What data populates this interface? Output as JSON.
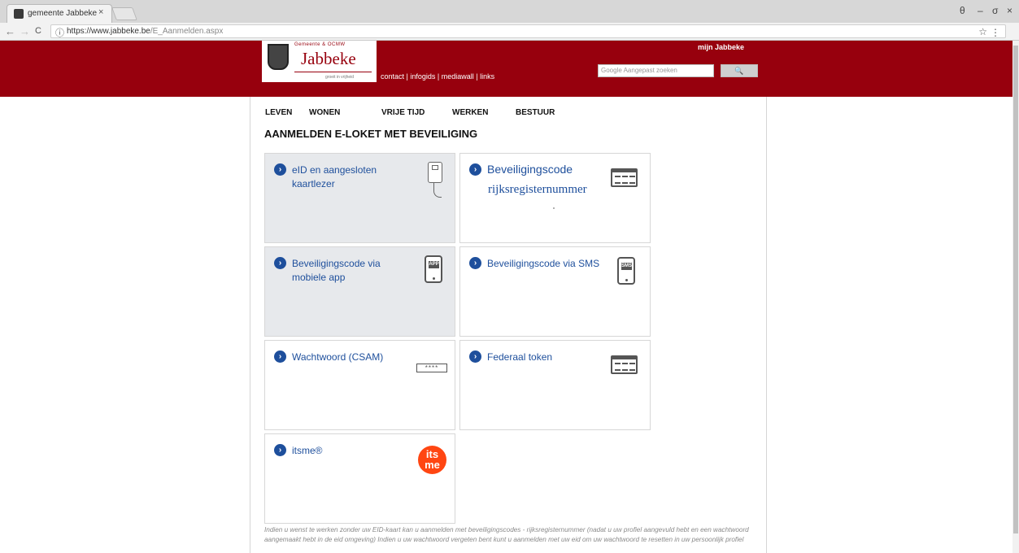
{
  "browser": {
    "tab_title": "gemeente Jabbeke",
    "tab_close": "×",
    "url_domain": "https://www.jabbeke.be",
    "url_path": "/E_Aanmelden.aspx",
    "win_account": "θ",
    "win_minimize": "–",
    "win_maximize": "σ",
    "win_close": "×",
    "back": "←",
    "forward": "→",
    "reload": "C",
    "info": "ⓘ",
    "star": "☆",
    "menu": "⋮"
  },
  "header": {
    "logo_top": "Gemeente & OCMW",
    "logo_name": "Jabbeke",
    "logo_tag": "groeit in vrijheid",
    "links": [
      "contact",
      "infogids",
      "mediawall",
      "links"
    ],
    "link_separator": " | ",
    "mijn": "mijn Jabbeke",
    "search_placeholder": "Google Aangepast zoeken",
    "search_button": "🔍"
  },
  "nav": [
    "LEVEN",
    "WONEN",
    "VRIJE TIJD",
    "WERKEN",
    "BESTUUR"
  ],
  "page_title": "AANMELDEN E-LOKET MET BEVEILIGING",
  "cards": {
    "arrow": "›",
    "eid": {
      "line1": "eID en aangesloten",
      "line2": "kaartlezer"
    },
    "code_rr": {
      "label": "Beveiligingscode",
      "sub": "rijksregisternummer"
    },
    "app": {
      "line1": "Beveiligingscode via",
      "line2": "mobiele app",
      "icon_text": "APP"
    },
    "sms": {
      "label": "Beveiligingscode via SMS",
      "icon_text": "SMS"
    },
    "csam": {
      "label": "Wachtwoord (CSAM)",
      "icon_text": "****"
    },
    "token": {
      "label": "Federaal token"
    },
    "itsme": {
      "label": "itsme®",
      "icon_line1": "its",
      "icon_line2": "me"
    }
  },
  "footer_text": "Indien u wenst te werken zonder uw EID-kaart kan u aanmelden met beveiligingscodes - rijksregisternummer (nadat u uw profiel aangevuld hebt en een wachtwoord aangemaakt hebt in de eid omgeving) Indien u uw wachtwoord vergeten bent kunt u aanmelden met uw eid om uw wachtwoord te resetten in uw persoonlijk profiel",
  "colors": {
    "brand": "#97000d",
    "link": "#1e4f9c",
    "itsme": "#ff4612"
  }
}
